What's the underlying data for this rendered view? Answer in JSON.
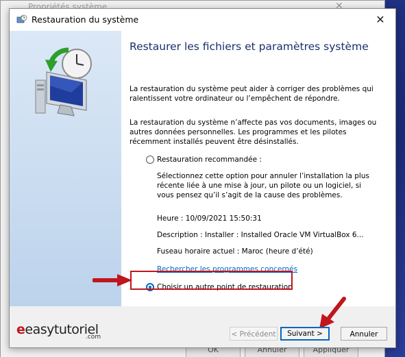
{
  "background_window": {
    "title": "Propriétés système",
    "buttons": [
      "OK",
      "Annuler",
      "Appliquer"
    ]
  },
  "dialog": {
    "title": "Restauration du système",
    "close_label": "✕",
    "heading": "Restaurer les fichiers et paramètres système",
    "para1": "La restauration du système peut aider à corriger des problèmes qui ralentissent votre ordinateur ou l’empêchent de répondre.",
    "para2": "La restauration du système n’affecte pas vos documents, images ou autres données personnelles. Les programmes et les pilotes récemment installés peuvent être désinstallés.",
    "options": {
      "recommended": {
        "label": "Restauration recommandée :",
        "checked": false,
        "description": "Sélectionnez cette option pour annuler l’installation la plus récente liée à une mise à jour, un pilote ou un logiciel, si vous pensez qu’il s’agit de la cause des problèmes.",
        "time": "Heure : 10/09/2021 15:50:31",
        "desc": "Description : Installer : Installed Oracle VM VirtualBox 6...",
        "timezone": "Fuseau horaire actuel : Maroc (heure d’été)",
        "link": "Rechercher les programmes concernés"
      },
      "other": {
        "label": "Choisir un autre point de restauration",
        "checked": true
      }
    },
    "buttons": {
      "previous": "< Précédent",
      "next": "Suivant >",
      "cancel": "Annuler"
    }
  },
  "watermark": {
    "brand": "easytutoriel",
    "suffix": ".com"
  },
  "colors": {
    "accent": "#0067c0",
    "annotation": "#c0161c",
    "heading": "#1a2e6c"
  }
}
